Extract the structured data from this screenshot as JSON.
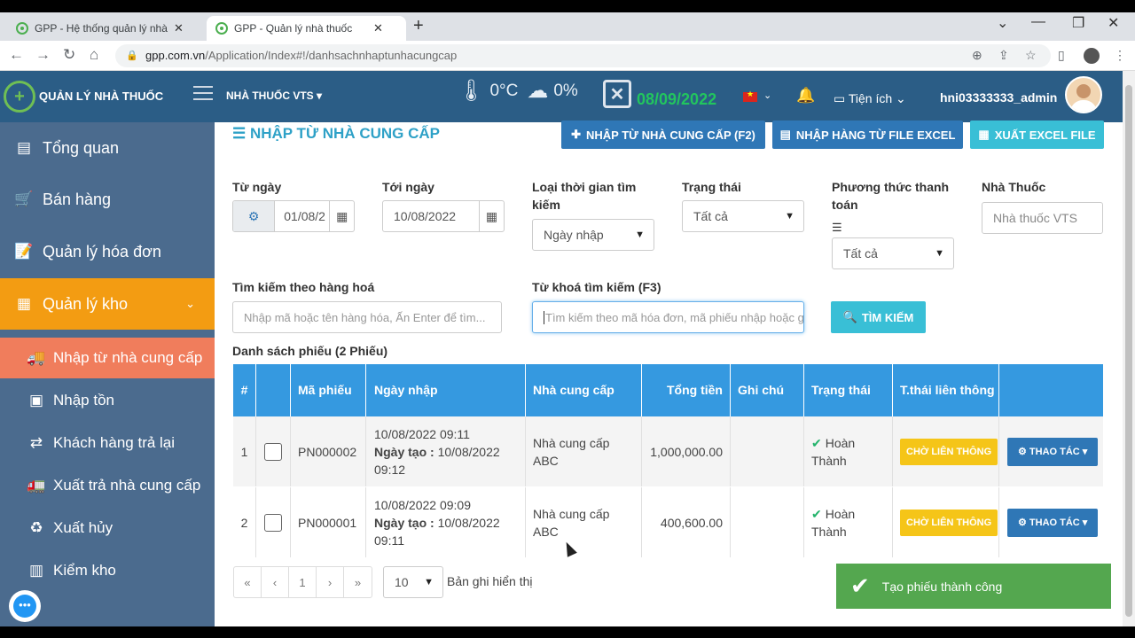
{
  "browser": {
    "tabs": [
      {
        "title": "GPP - Hệ thống quản lý nhà thuốc",
        "close": "✕"
      },
      {
        "title": "GPP - Quản lý nhà thuốc",
        "close": "✕"
      }
    ],
    "new_tab": "+",
    "url_host": "gpp.com.vn",
    "url_path": "/Application/Index#!/danhsachnhaptunhacungcap"
  },
  "header": {
    "brand": "QUẢN LÝ NHÀ THUỐC",
    "pharmacy": "NHÀ THUỐC VTS ▾",
    "temperature": "0°C",
    "humidity": "0%",
    "date": "08/09/2022",
    "utilities": "Tiện ích",
    "username": "hni03333333_admin",
    "colors": {
      "bar": "#2b5d86",
      "date": "#22c55e"
    }
  },
  "sidebar": {
    "menu": [
      {
        "label": "Tổng quan",
        "icon": "dashboard-icon"
      },
      {
        "label": "Bán hàng",
        "icon": "cart-icon"
      },
      {
        "label": "Quản lý hóa đơn",
        "icon": "invoice-icon"
      },
      {
        "label": "Quản lý kho",
        "icon": "warehouse-icon"
      }
    ],
    "submenu": [
      {
        "label": "Nhập từ nhà cung cấp",
        "icon": "truck-icon"
      },
      {
        "label": "Nhập tồn",
        "icon": "inventory-icon"
      },
      {
        "label": "Khách hàng trả lại",
        "icon": "return-icon"
      },
      {
        "label": "Xuất trả nhà cung cấp",
        "icon": "truck-return-icon"
      },
      {
        "label": "Xuất hủy",
        "icon": "cancel-export-icon"
      },
      {
        "label": "Kiểm kho",
        "icon": "stock-check-icon"
      }
    ],
    "colors": {
      "bg": "#4b6b8e",
      "active": "#f39c12",
      "sub_active": "#f07d5c"
    }
  },
  "page": {
    "title": "NHẬP TỪ NHÀ CUNG CẤP",
    "buttons": {
      "import_supplier": "NHẬP TỪ NHÀ CUNG CẤP (F2)",
      "import_excel": "NHẬP HÀNG TỪ FILE EXCEL",
      "export_excel": "XUẤT EXCEL FILE"
    },
    "filters": {
      "from_date_label": "Từ ngày",
      "from_date_value": "01/08/2",
      "to_date_label": "Tới ngày",
      "to_date_value": "10/08/2022",
      "time_type_label": "Loại thời gian tìm kiếm",
      "time_type_value": "Ngày nhập",
      "status_label": "Trạng thái",
      "status_value": "Tất cả",
      "payment_label": "Phương thức thanh toán",
      "payment_value": "Tất cả",
      "pharmacy_label": "Nhà Thuốc",
      "pharmacy_placeholder": "Nhà thuốc VTS",
      "product_search_label": "Tìm kiếm theo hàng hoá",
      "product_search_placeholder": "Nhập mã hoặc tên hàng hóa, Ấn Enter để tìm...",
      "keyword_label": "Từ khoá tìm kiếm (F3)",
      "keyword_placeholder": "Tìm kiếm theo mã hóa đơn, mã phiếu nhập hoặc ghi chú",
      "search_button": "TÌM KIẾM"
    },
    "list_label": "Danh sách phiếu (2 Phiếu)",
    "table": {
      "headers": [
        "#",
        "",
        "Mã phiếu",
        "Ngày nhập",
        "Nhà cung cấp",
        "Tổng tiền",
        "Ghi chú",
        "Trạng thái",
        "T.thái liên thông",
        ""
      ],
      "rows": [
        {
          "no": "1",
          "code": "PN000002",
          "date": "10/08/2022 09:11",
          "created_label": "Ngày tạo :",
          "created": "10/08/2022 09:12",
          "supplier": "Nhà cung cấp ABC",
          "total": "1,000,000.00",
          "note": "",
          "status": "Hoàn Thành",
          "sync": "CHỜ LIÊN THÔNG",
          "action": "THAO TÁC"
        },
        {
          "no": "2",
          "code": "PN000001",
          "date": "10/08/2022 09:09",
          "created_label": "Ngày tạo :",
          "created": "10/08/2022 09:11",
          "supplier": "Nhà cung cấp ABC",
          "total": "400,600.00",
          "note": "",
          "status": "Hoàn Thành",
          "sync": "CHỜ LIÊN THÔNG",
          "action": "THAO TÁC"
        }
      ]
    },
    "pagination": {
      "first": "«",
      "prev": "‹",
      "current": "1",
      "next": "›",
      "last": "»",
      "per_page": "10",
      "per_page_label": "Bản ghi hiển thị"
    },
    "toast": "Tạo phiếu thành công"
  }
}
